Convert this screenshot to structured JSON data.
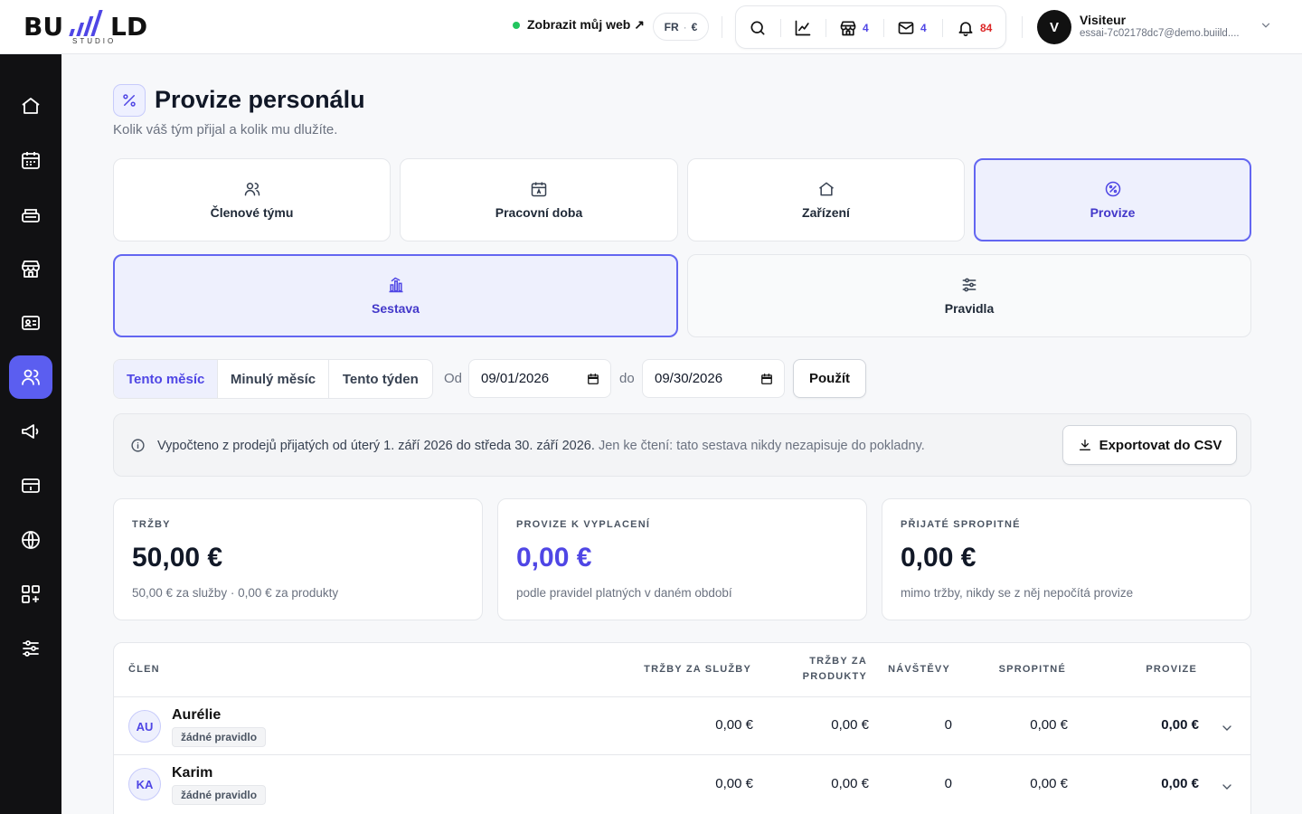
{
  "brand": {
    "logo_text": "BUILD",
    "logo_sub": "STUDIO"
  },
  "topbar": {
    "site_link": "Zobrazit můj web ↗",
    "lang": "FR",
    "currency": "€",
    "tools": [
      {
        "icon": "search-icon"
      },
      {
        "icon": "chart-line-icon"
      },
      {
        "icon": "store-icon",
        "count": "4"
      },
      {
        "icon": "mail-icon",
        "count": "4"
      },
      {
        "icon": "bell-icon",
        "count": "84"
      }
    ]
  },
  "user": {
    "initial": "V",
    "name": "Visiteur",
    "email": "essai-7c02178dc7@demo.buiild...."
  },
  "sidebar": {
    "items": [
      {
        "icon": "home-icon"
      },
      {
        "icon": "calendar-icon"
      },
      {
        "icon": "register-icon"
      },
      {
        "icon": "shop-icon"
      },
      {
        "icon": "contact-card-icon"
      },
      {
        "icon": "users-icon",
        "active": true
      },
      {
        "icon": "megaphone-icon"
      },
      {
        "icon": "card-icon"
      },
      {
        "icon": "globe-icon"
      },
      {
        "icon": "apps-icon"
      },
      {
        "icon": "sliders-icon"
      }
    ]
  },
  "page": {
    "title": "Provize personálu",
    "subtitle": "Kolik váš tým přijal a kolik mu dlužíte."
  },
  "nav_tiles": [
    {
      "label": "Členové týmu",
      "icon": "users-icon"
    },
    {
      "label": "Pracovní doba",
      "icon": "calendar-icon"
    },
    {
      "label": "Zařízení",
      "icon": "home-icon"
    },
    {
      "label": "Provize",
      "icon": "percent-icon",
      "active": true
    }
  ],
  "sub_tiles": [
    {
      "label": "Sestava",
      "icon": "bar-chart-icon",
      "active": true
    },
    {
      "label": "Pravidla",
      "icon": "sliders-icon"
    }
  ],
  "filters": {
    "presets": [
      "Tento měsíc",
      "Minulý měsíc",
      "Tento týden"
    ],
    "active_preset": "Tento měsíc",
    "from_label": "Od",
    "from_value": "09/01/2026",
    "to_label": "do",
    "to_value": "09/30/2026",
    "apply_label": "Použít"
  },
  "info": {
    "main": "Vypočteno z prodejů přijatých od úterý 1. září 2026 do středa 30. září 2026.",
    "muted": "Jen ke čtení: tato sestava nikdy nezapisuje do pokladny.",
    "export_label": "Exportovat do CSV"
  },
  "stats": [
    {
      "label": "TRŽBY",
      "value": "50,00 €",
      "note": "50,00 € za služby · 0,00 € za produkty"
    },
    {
      "label": "PROVIZE K VYPLACENÍ",
      "value": "0,00 €",
      "note": "podle pravidel platných v daném období"
    },
    {
      "label": "PŘIJATÉ SPROPITNÉ",
      "value": "0,00 €",
      "note": "mimo tržby, nikdy se z něj nepočítá provize"
    }
  ],
  "table": {
    "headers": {
      "member": "ČLEN",
      "services": "TRŽBY ZA SLUŽBY",
      "products_1": "TRŽBY ZA",
      "products_2": "PRODUKTY",
      "visits": "NÁVŠTĚVY",
      "tips": "SPROPITNÉ",
      "commission": "PROVIZE"
    },
    "rows": [
      {
        "initials": "AU",
        "name": "Aurélie",
        "badge": "žádné pravidlo",
        "services": "0,00 €",
        "products": "0,00 €",
        "visits": "0",
        "tips": "0,00 €",
        "commission": "0,00 €"
      },
      {
        "initials": "KA",
        "name": "Karim",
        "badge": "žádné pravidlo",
        "services": "0,00 €",
        "products": "0,00 €",
        "visits": "0",
        "tips": "0,00 €",
        "commission": "0,00 €"
      }
    ]
  }
}
